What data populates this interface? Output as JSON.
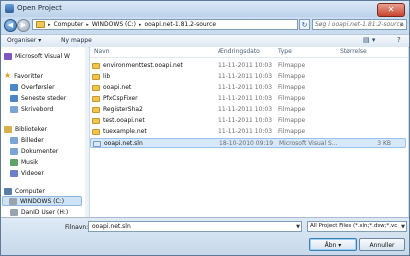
{
  "window": {
    "title": "Open Project",
    "close_glyph": "✕"
  },
  "nav": {
    "back_glyph": "◀",
    "forward_glyph": "▶",
    "refresh_glyph": "↻",
    "breadcrumbs": [
      "Computer",
      "WINDOWS (C:)",
      "ooapi.net-1.81.2-source"
    ],
    "separator": "▸",
    "search_placeholder": "Søg i ooapi.net-1.81.2-source",
    "search_icon_glyph": "⌕"
  },
  "toolbar": {
    "organize": "Organiser ▾",
    "new_folder": "Ny mappe",
    "views_glyph": "▤ ▾",
    "help_glyph": "?"
  },
  "sidebar": {
    "items": [
      {
        "label": "Microsoft Visual W",
        "icon": "vs-icon",
        "indent": false
      },
      {
        "label": "Favoritter",
        "icon": "star-icon",
        "indent": false
      },
      {
        "label": "Overførsler",
        "icon": "downloads-icon",
        "indent": true
      },
      {
        "label": "Seneste steder",
        "icon": "recent-places-icon",
        "indent": true
      },
      {
        "label": "Skrivebord",
        "icon": "desktop-icon",
        "indent": true
      },
      {
        "label": "Biblioteker",
        "icon": "libraries-icon",
        "indent": false
      },
      {
        "label": "Billeder",
        "icon": "pictures-icon",
        "indent": true
      },
      {
        "label": "Dokumenter",
        "icon": "documents-icon",
        "indent": true
      },
      {
        "label": "Musik",
        "icon": "music-icon",
        "indent": true
      },
      {
        "label": "Videoer",
        "icon": "videos-icon",
        "indent": true
      },
      {
        "label": "Computer",
        "icon": "computer-icon",
        "indent": false
      },
      {
        "label": "WINDOWS (C:)",
        "icon": "drive-icon",
        "indent": true,
        "selected": true
      },
      {
        "label": "DanID User (H:)",
        "icon": "drive-icon",
        "indent": true
      }
    ]
  },
  "columns": {
    "name": "Navn",
    "date": "Ændringsdato",
    "type": "Type",
    "size": "Størrelse"
  },
  "files": [
    {
      "name": "environmenttest.ooapi.net",
      "date": "11-11-2011 10:03",
      "type": "Filmappe",
      "size": "",
      "kind": "folder"
    },
    {
      "name": "lib",
      "date": "11-11-2011 10:03",
      "type": "Filmappe",
      "size": "",
      "kind": "folder"
    },
    {
      "name": "ooapi.net",
      "date": "11-11-2011 10:03",
      "type": "Filmappe",
      "size": "",
      "kind": "folder"
    },
    {
      "name": "PfxCspFixer",
      "date": "11-11-2011 10:03",
      "type": "Filmappe",
      "size": "",
      "kind": "folder"
    },
    {
      "name": "RegisterSha2",
      "date": "11-11-2011 10:03",
      "type": "Filmappe",
      "size": "",
      "kind": "folder"
    },
    {
      "name": "test.ooapi.net",
      "date": "11-11-2011 10:03",
      "type": "Filmappe",
      "size": "",
      "kind": "folder"
    },
    {
      "name": "tuexample.net",
      "date": "11-11-2011 10:03",
      "type": "Filmappe",
      "size": "",
      "kind": "folder"
    },
    {
      "name": "ooapi.net.sln",
      "date": "18-10-2010 09:19",
      "type": "Microsoft Visual S...",
      "size": "3 KB",
      "kind": "file",
      "selected": true
    }
  ],
  "footer": {
    "filename_label": "Filnavn:",
    "filename_value": "ooapi.net.sln",
    "filter_value": "All Project Files (*.sln;*.dsw;*.vc",
    "dropdown_glyph": "▼",
    "open_label": "Åbn ▾",
    "cancel_label": "Annuller"
  },
  "colors": {
    "accent": "#3c7fb1",
    "folder": "#f1c44e",
    "selection": "#d6e8fa"
  }
}
